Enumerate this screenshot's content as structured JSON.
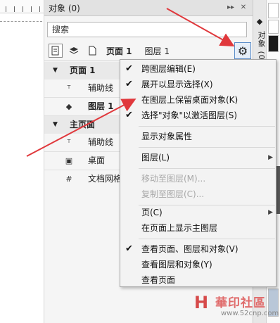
{
  "panel": {
    "title": "对象 (0)",
    "title_buttons": [
      "▸▸",
      "✕"
    ],
    "search_placeholder": "搜索",
    "toolbar": {
      "page_label": "页面 1",
      "layer_label": "图层 1"
    }
  },
  "tree": [
    {
      "kind": "section",
      "label": "页面 1"
    },
    {
      "kind": "item",
      "icon": "guides",
      "label": "辅助线"
    },
    {
      "kind": "item",
      "icon": "layers",
      "label": "图层 1"
    },
    {
      "kind": "section",
      "label": "主页面"
    },
    {
      "kind": "item",
      "icon": "guides",
      "label": "辅助线"
    },
    {
      "kind": "item",
      "icon": "desktop",
      "label": "桌面"
    },
    {
      "kind": "item",
      "icon": "grid",
      "label": "文档网格"
    }
  ],
  "side_tab": {
    "label": "对象 (0)"
  },
  "menu": {
    "items": [
      {
        "label": "跨图层编辑(E)",
        "checked": true,
        "disabled": false
      },
      {
        "label": "展开以显示选择(X)",
        "checked": true,
        "disabled": false
      },
      {
        "label": "在图层上保留桌面对象(K)",
        "checked": false,
        "disabled": false
      },
      {
        "label": "选择\"对象\"以激活图层(S)",
        "checked": true,
        "disabled": false
      },
      {
        "label": "显示对象属性",
        "checked": false,
        "disabled": false
      },
      {
        "label": "图层(L)",
        "checked": false,
        "disabled": false,
        "submenu": true
      },
      {
        "label": "移动至图层(M)...",
        "checked": false,
        "disabled": true
      },
      {
        "label": "复制至图层(C)...",
        "checked": false,
        "disabled": true
      },
      {
        "label": "页(C)",
        "checked": false,
        "disabled": false,
        "submenu": true
      },
      {
        "label": "在页面上显示主图层",
        "checked": false,
        "disabled": false
      },
      {
        "label": "查看页面、图层和对象(V)",
        "checked": true,
        "disabled": false
      },
      {
        "label": "查看图层和对象(Y)",
        "checked": false,
        "disabled": false
      },
      {
        "label": "查看页面",
        "checked": false,
        "disabled": false
      }
    ]
  },
  "watermark": {
    "brand": "華印社區",
    "url": "www.52cnp.com"
  },
  "colors": {
    "accent": "#5b8dc9",
    "annotation_arrow": "#e0383c"
  }
}
